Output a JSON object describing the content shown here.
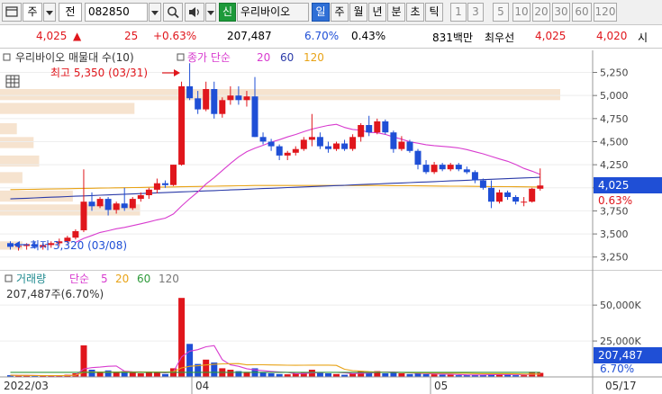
{
  "toolbar": {
    "window_icon": "window-icon",
    "market_label": "주",
    "search_label": "전",
    "code_value": "082850",
    "credit_badge": "신",
    "stock_name": "우리바이오",
    "period_tabs": [
      "일",
      "주",
      "월",
      "년",
      "분",
      "초",
      "틱"
    ],
    "active_period": "일",
    "interval_tabs": [
      "1",
      "3",
      "5",
      "10",
      "20",
      "30",
      "60",
      "120"
    ]
  },
  "quote": {
    "price": "4,025",
    "change": "25",
    "change_pct": "+0.63%",
    "volume": "207,487",
    "turnover_pct": "6.70%",
    "other_pct": "0.43%",
    "amount": "831백만",
    "best_ask_label": "최우선",
    "ask": "4,025",
    "bid": "4,020",
    "tail_char": "시"
  },
  "price_panel": {
    "legend_name": "우리바이오 매물대 수(10)",
    "ma_label": "종가 단순",
    "ma_periods": [
      "20",
      "60",
      "120"
    ],
    "high_annotation": "최고 5,350 (03/31)",
    "low_annotation": "최저 3,320 (03/08)",
    "y_ticks": [
      "5,250",
      "5,000",
      "4,750",
      "4,500",
      "4,250",
      "4,000",
      "3,750",
      "3,500",
      "3,250"
    ],
    "current_price_tag": "4,025",
    "current_pct_tag": "0.63%"
  },
  "volume_panel": {
    "legend_name": "거래량",
    "ma_label": "단순",
    "ma_periods": [
      "5",
      "20",
      "60",
      "120"
    ],
    "value_text": "207,487주(6.70%)",
    "y_ticks": [
      "50,000K",
      "25,000K"
    ],
    "current_volume_tag": "207,487",
    "current_pct_tag": "6.70%"
  },
  "date_axis": [
    "2022/03",
    "04",
    "05",
    "05/17"
  ],
  "colors": {
    "up": "#e0161c",
    "down": "#1f4fd6",
    "ma20": "#d83ccf",
    "ma60": "#2a3aa8",
    "ma120": "#e8a317",
    "volume_profile": "#f6e3cf",
    "tag_blue": "#1f4fd6"
  },
  "chart_data": {
    "type": "candlestick",
    "ylim": [
      3150,
      5450
    ],
    "volume_ylim": [
      0,
      62000
    ],
    "volume_profile": [
      {
        "price_low": 4950,
        "price_high": 5070,
        "relative": 1.0
      },
      {
        "price_low": 4800,
        "price_high": 4920,
        "relative": 0.24
      },
      {
        "price_low": 4580,
        "price_high": 4700,
        "relative": 0.03
      },
      {
        "price_low": 4430,
        "price_high": 4550,
        "relative": 0.06
      },
      {
        "price_low": 4230,
        "price_high": 4350,
        "relative": 0.07
      },
      {
        "price_low": 4050,
        "price_high": 4170,
        "relative": 0.04
      },
      {
        "price_low": 3850,
        "price_high": 3970,
        "relative": 0.13
      },
      {
        "price_low": 3700,
        "price_high": 3820,
        "relative": 0.25
      },
      {
        "price_low": 3330,
        "price_high": 3420,
        "relative": 0.04
      }
    ],
    "candles": [
      {
        "o": 3400,
        "h": 3420,
        "l": 3330,
        "c": 3360,
        "v": 1200
      },
      {
        "o": 3360,
        "h": 3400,
        "l": 3320,
        "c": 3370,
        "v": 900
      },
      {
        "o": 3370,
        "h": 3400,
        "l": 3330,
        "c": 3390,
        "v": 1000
      },
      {
        "o": 3390,
        "h": 3420,
        "l": 3340,
        "c": 3360,
        "v": 800
      },
      {
        "o": 3360,
        "h": 3400,
        "l": 3330,
        "c": 3380,
        "v": 700
      },
      {
        "o": 3380,
        "h": 3420,
        "l": 3350,
        "c": 3400,
        "v": 900
      },
      {
        "o": 3400,
        "h": 3450,
        "l": 3370,
        "c": 3420,
        "v": 1100
      },
      {
        "o": 3420,
        "h": 3480,
        "l": 3400,
        "c": 3460,
        "v": 1500
      },
      {
        "o": 3460,
        "h": 3550,
        "l": 3440,
        "c": 3530,
        "v": 2500
      },
      {
        "o": 3540,
        "h": 4200,
        "l": 3520,
        "c": 3850,
        "v": 22000
      },
      {
        "o": 3850,
        "h": 3950,
        "l": 3750,
        "c": 3800,
        "v": 5000
      },
      {
        "o": 3800,
        "h": 3900,
        "l": 3780,
        "c": 3880,
        "v": 3000
      },
      {
        "o": 3880,
        "h": 3900,
        "l": 3700,
        "c": 3760,
        "v": 4500
      },
      {
        "o": 3760,
        "h": 3850,
        "l": 3720,
        "c": 3830,
        "v": 3500
      },
      {
        "o": 3830,
        "h": 4000,
        "l": 3750,
        "c": 3780,
        "v": 4000
      },
      {
        "o": 3780,
        "h": 3900,
        "l": 3760,
        "c": 3880,
        "v": 3000
      },
      {
        "o": 3880,
        "h": 3950,
        "l": 3850,
        "c": 3920,
        "v": 2500
      },
      {
        "o": 3920,
        "h": 4000,
        "l": 3880,
        "c": 3980,
        "v": 3000
      },
      {
        "o": 3980,
        "h": 4100,
        "l": 3940,
        "c": 4050,
        "v": 3500
      },
      {
        "o": 4050,
        "h": 4080,
        "l": 4000,
        "c": 4030,
        "v": 2000
      },
      {
        "o": 4030,
        "h": 4250,
        "l": 4020,
        "c": 4250,
        "v": 6000
      },
      {
        "o": 4250,
        "h": 5150,
        "l": 4240,
        "c": 5100,
        "v": 55000
      },
      {
        "o": 5100,
        "h": 5350,
        "l": 4950,
        "c": 4970,
        "v": 23000
      },
      {
        "o": 4970,
        "h": 5050,
        "l": 4800,
        "c": 4850,
        "v": 9000
      },
      {
        "o": 4850,
        "h": 5150,
        "l": 4830,
        "c": 5070,
        "v": 12000
      },
      {
        "o": 5070,
        "h": 5150,
        "l": 4750,
        "c": 4800,
        "v": 10000
      },
      {
        "o": 4800,
        "h": 4980,
        "l": 4760,
        "c": 4950,
        "v": 6000
      },
      {
        "o": 4950,
        "h": 5100,
        "l": 4900,
        "c": 5000,
        "v": 5000
      },
      {
        "o": 5000,
        "h": 5100,
        "l": 4900,
        "c": 4950,
        "v": 4000
      },
      {
        "o": 4950,
        "h": 5050,
        "l": 4880,
        "c": 4990,
        "v": 3500
      },
      {
        "o": 4990,
        "h": 5200,
        "l": 4550,
        "c": 4550,
        "v": 6000
      },
      {
        "o": 4550,
        "h": 4600,
        "l": 4470,
        "c": 4500,
        "v": 3000
      },
      {
        "o": 4500,
        "h": 4530,
        "l": 4400,
        "c": 4450,
        "v": 2500
      },
      {
        "o": 4450,
        "h": 4470,
        "l": 4300,
        "c": 4350,
        "v": 2000
      },
      {
        "o": 4350,
        "h": 4400,
        "l": 4300,
        "c": 4380,
        "v": 1800
      },
      {
        "o": 4380,
        "h": 4450,
        "l": 4350,
        "c": 4420,
        "v": 2200
      },
      {
        "o": 4420,
        "h": 4550,
        "l": 4400,
        "c": 4520,
        "v": 3000
      },
      {
        "o": 4520,
        "h": 4800,
        "l": 4450,
        "c": 4550,
        "v": 5000
      },
      {
        "o": 4550,
        "h": 4600,
        "l": 4420,
        "c": 4450,
        "v": 3000
      },
      {
        "o": 4450,
        "h": 4500,
        "l": 4380,
        "c": 4420,
        "v": 2500
      },
      {
        "o": 4420,
        "h": 4500,
        "l": 4400,
        "c": 4480,
        "v": 2000
      },
      {
        "o": 4480,
        "h": 4520,
        "l": 4400,
        "c": 4420,
        "v": 1500
      },
      {
        "o": 4420,
        "h": 4580,
        "l": 4400,
        "c": 4550,
        "v": 2500
      },
      {
        "o": 4550,
        "h": 4700,
        "l": 4500,
        "c": 4680,
        "v": 4000
      },
      {
        "o": 4680,
        "h": 4780,
        "l": 4560,
        "c": 4600,
        "v": 3500
      },
      {
        "o": 4600,
        "h": 4750,
        "l": 4580,
        "c": 4720,
        "v": 4000
      },
      {
        "o": 4720,
        "h": 4740,
        "l": 4580,
        "c": 4600,
        "v": 2500
      },
      {
        "o": 4600,
        "h": 4620,
        "l": 4380,
        "c": 4420,
        "v": 3000
      },
      {
        "o": 4420,
        "h": 4560,
        "l": 4400,
        "c": 4500,
        "v": 2500
      },
      {
        "o": 4500,
        "h": 4520,
        "l": 4380,
        "c": 4400,
        "v": 2000
      },
      {
        "o": 4400,
        "h": 4420,
        "l": 4200,
        "c": 4250,
        "v": 2500
      },
      {
        "o": 4250,
        "h": 4300,
        "l": 4150,
        "c": 4170,
        "v": 2000
      },
      {
        "o": 4170,
        "h": 4280,
        "l": 4150,
        "c": 4250,
        "v": 1800
      },
      {
        "o": 4250,
        "h": 4270,
        "l": 4180,
        "c": 4200,
        "v": 1500
      },
      {
        "o": 4200,
        "h": 4270,
        "l": 4180,
        "c": 4250,
        "v": 1500
      },
      {
        "o": 4250,
        "h": 4270,
        "l": 4180,
        "c": 4200,
        "v": 1200
      },
      {
        "o": 4200,
        "h": 4230,
        "l": 4150,
        "c": 4170,
        "v": 1200
      },
      {
        "o": 4170,
        "h": 4190,
        "l": 4050,
        "c": 4080,
        "v": 1500
      },
      {
        "o": 4080,
        "h": 4100,
        "l": 3980,
        "c": 4000,
        "v": 1500
      },
      {
        "o": 4000,
        "h": 4080,
        "l": 3780,
        "c": 3850,
        "v": 2500
      },
      {
        "o": 3850,
        "h": 3980,
        "l": 3830,
        "c": 3950,
        "v": 1800
      },
      {
        "o": 3950,
        "h": 3970,
        "l": 3870,
        "c": 3900,
        "v": 1500
      },
      {
        "o": 3900,
        "h": 3920,
        "l": 3820,
        "c": 3850,
        "v": 1200
      },
      {
        "o": 3850,
        "h": 3900,
        "l": 3800,
        "c": 3850,
        "v": 1200
      },
      {
        "o": 3850,
        "h": 4000,
        "l": 3840,
        "c": 3990,
        "v": 3500
      },
      {
        "o": 3990,
        "h": 4210,
        "l": 3970,
        "c": 4025,
        "v": 2800
      }
    ]
  }
}
